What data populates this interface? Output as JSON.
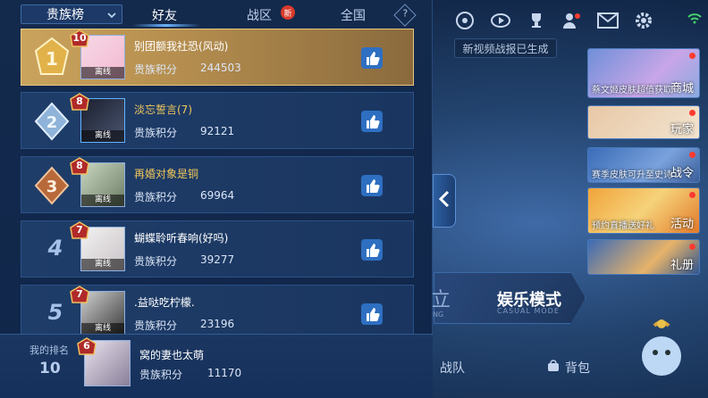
{
  "tabs": {
    "dropdown_value": "贵族榜",
    "friends": "好友",
    "region": "战区",
    "region_badge": "新",
    "nationwide": "全国",
    "help": "?"
  },
  "rows": [
    {
      "rank": "1",
      "level": "10",
      "status": "离线",
      "name": "别团额我社恐(风动)",
      "score_label": "贵族积分",
      "score": "244503"
    },
    {
      "rank": "2",
      "level": "8",
      "status": "离线",
      "name": "淡忘誓言(7)",
      "score_label": "贵族积分",
      "score": "92121"
    },
    {
      "rank": "3",
      "level": "8",
      "status": "离线",
      "name": "再婚对象是铜",
      "score_label": "贵族积分",
      "score": "69964"
    },
    {
      "rank": "4",
      "level": "7",
      "status": "离线",
      "name": "蝴蝶聆听春响(好吗)",
      "score_label": "贵族积分",
      "score": "39277"
    },
    {
      "rank": "5",
      "level": "7",
      "status": "离线",
      "name": ".益哒吃柠檬.",
      "score_label": "贵族积分",
      "score": "23196"
    }
  ],
  "mine": {
    "label": "我的排名",
    "rank": "10",
    "level": "6",
    "name": "窝的妻也太萌",
    "score_label": "贵族积分",
    "score": "11170"
  },
  "game": {
    "replay_toast": "新视频战报已生成",
    "side_cards": [
      {
        "label": "商城",
        "caption": "蔡文姬皮肤超值获取"
      },
      {
        "label": "玩家",
        "caption": ""
      },
      {
        "label": "战令",
        "caption": "赛季皮肤可升至史诗"
      },
      {
        "label": "活动",
        "caption": "预约直播送好礼"
      },
      {
        "label": "礼册",
        "caption": ""
      }
    ],
    "mode_left": "立",
    "mode_title": "娱乐模式",
    "mode_sub": "CASUAL MODE",
    "mode_left_sub": "NG",
    "team_btn": "战队",
    "bag_btn": "背包"
  },
  "colors": {
    "gold_row": "#caa45d",
    "name_gold": "#f1c75a",
    "panel_bg": "#132a4d",
    "accent_blue": "#6ab4ff"
  },
  "icons": [
    "map-target-icon",
    "replay-icon",
    "trophy-icon",
    "friends-icon",
    "mail-icon",
    "settings-icon",
    "wifi-icon",
    "thumbs-up-icon",
    "help-icon"
  ]
}
